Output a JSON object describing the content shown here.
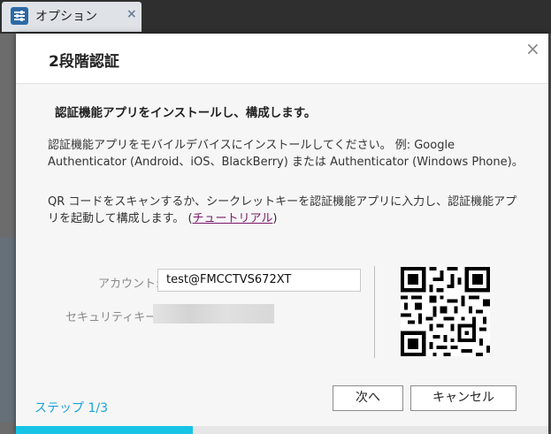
{
  "tab": {
    "title": "オプション",
    "close_glyph": "×",
    "icon": "sliders-icon"
  },
  "dialog": {
    "title": "2段階認証",
    "close_glyph": "×",
    "subtitle": "認証機能アプリをインストールし、構成します。",
    "para1": "認証機能アプリをモバイルデバイスにインストールしてください。 例: Google Authenticator (Android、iOS、BlackBerry) または Authenticator (Windows Phone)。",
    "para2_text": "QR コードをスキャンするか、シークレットキーを認証機能アプリに入力し、認証機能アプリを起動して構成します。 (",
    "para2_link": "チュートリアル",
    "para2_end": ")",
    "account_label": "アカウント:",
    "account_value": "test@FMCCTVS672XT",
    "security_label": "セキュリティキー:",
    "step": "ステップ 1/3",
    "next_label": "次へ",
    "cancel_label": "キャンセル",
    "progress": 0.333
  },
  "colors": {
    "accent": "#17c4e6",
    "step_text": "#1aa3d9",
    "link": "#7a1a6a",
    "tab_icon": "#2c6aa6"
  }
}
